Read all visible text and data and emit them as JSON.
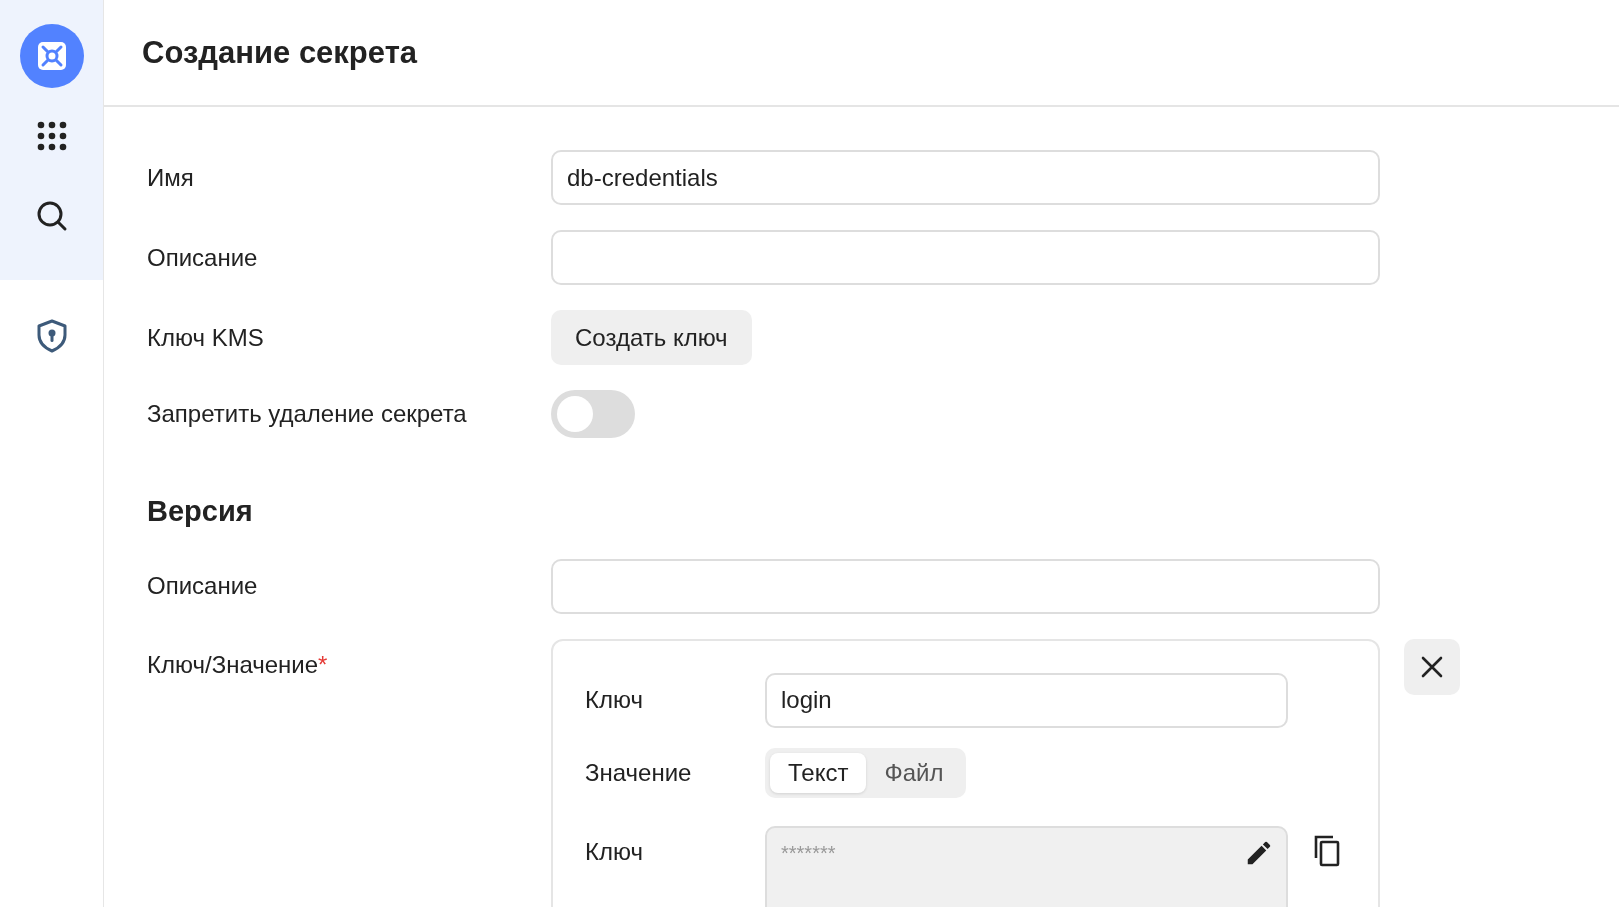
{
  "page_title": "Создание секрета",
  "sidebar": {
    "items": [
      {
        "kind": "logo",
        "selected": true
      },
      {
        "kind": "apps",
        "selected": false
      },
      {
        "kind": "search",
        "selected": false
      },
      {
        "kind": "shield",
        "selected": false
      }
    ]
  },
  "fields": [
    {
      "kind": "input",
      "label": "Имя",
      "value": "db-credentials"
    },
    {
      "kind": "input",
      "label": "Описание"
    },
    {
      "kind": "button",
      "label": "Ключ KMS",
      "button": "Создать ключ"
    },
    {
      "kind": "toggle",
      "label": "Запретить удаление секрета",
      "on": false
    }
  ],
  "version": {
    "heading": "Версия",
    "fields": [
      {
        "kind": "input",
        "label": "Описание"
      }
    ],
    "entries_label": "Ключ/Значение",
    "required_mark": "*",
    "entries": [
      {
        "key_label": "Ключ",
        "key": "login",
        "value_label": "Значение",
        "tabs": [
          {
            "label": "Текст",
            "selected": true
          },
          {
            "label": "Файл",
            "selected": false
          }
        ],
        "secret_label": "Ключ",
        "secret": "*******"
      }
    ]
  }
}
